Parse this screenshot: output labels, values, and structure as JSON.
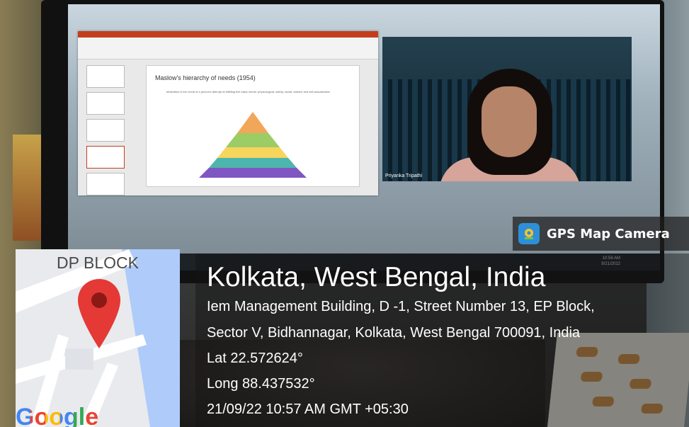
{
  "photo": {
    "slide": {
      "heading": "Maslow's hierarchy of needs (1954)",
      "bullet": "Motivation is the result of a person's attempt at fulfilling five basic needs: physiological, safety, social, esteem and self-actualization"
    },
    "video_name": "Priyanka Tripathi",
    "clock": {
      "time": "10:58 AM",
      "date": "9/21/2022"
    }
  },
  "gps_badge": {
    "label": "GPS Map Camera",
    "icon": "gps-camera-logo-icon"
  },
  "map": {
    "title": "DP BLOCK",
    "brand": "Google",
    "pin_icon": "map-pin-icon",
    "pin_color": "#e53935"
  },
  "location": {
    "city": "Kolkata, West Bengal, India",
    "address_line1": "Iem Management Building, D -1, Street Number 13, EP Block,",
    "address_line2": "Sector V, Bidhannagar, Kolkata, West Bengal 700091, India",
    "latitude": "Lat 22.572624°",
    "longitude": "Long 88.437532°",
    "timestamp": "21/09/22 10:57 AM GMT +05:30"
  }
}
